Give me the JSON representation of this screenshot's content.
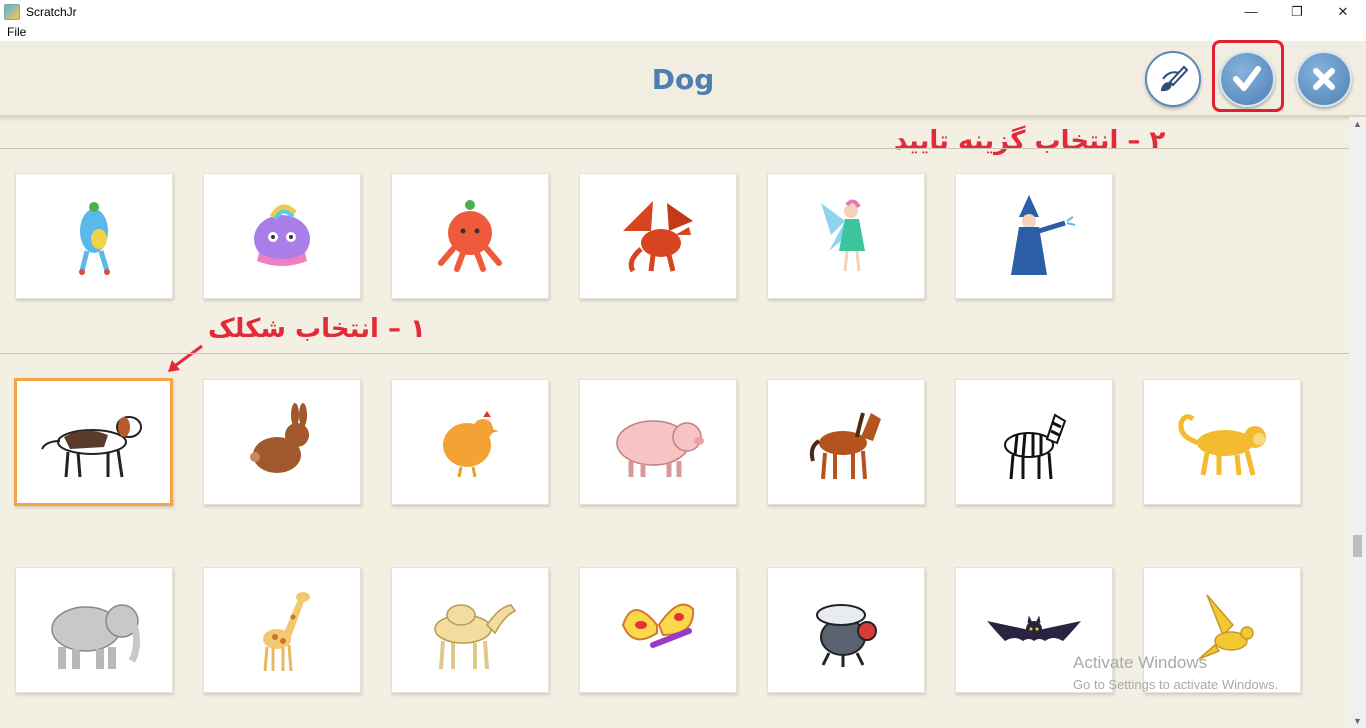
{
  "window": {
    "title": "ScratchJr",
    "controls": [
      "minimize",
      "restore",
      "close"
    ]
  },
  "menu": {
    "items": [
      "File"
    ]
  },
  "header": {
    "title": "Dog"
  },
  "annotations": {
    "step2": "۲ – انتخاب گزینه تایید",
    "step1": "۱ – انتخاب شکلک"
  },
  "library": {
    "rows": [
      {
        "sprites": [
          "blue-character",
          "purple-monster",
          "red-octopus",
          "dragon",
          "fairy",
          "wizard"
        ]
      },
      {
        "sprites": [
          "dog",
          "rabbit",
          "chicken",
          "pig",
          "horse",
          "zebra",
          "monkey"
        ],
        "selected": "dog"
      },
      {
        "sprites": [
          "elephant",
          "giraffe",
          "camel",
          "butterfly",
          "fly",
          "bat",
          "bird"
        ]
      }
    ]
  },
  "watermark": {
    "line1": "Activate Windows",
    "line2": "Go to Settings to activate Windows."
  },
  "colors": {
    "accent": "#4f7fb0",
    "selection": "#f3a445",
    "annotation": "#e22a38"
  }
}
